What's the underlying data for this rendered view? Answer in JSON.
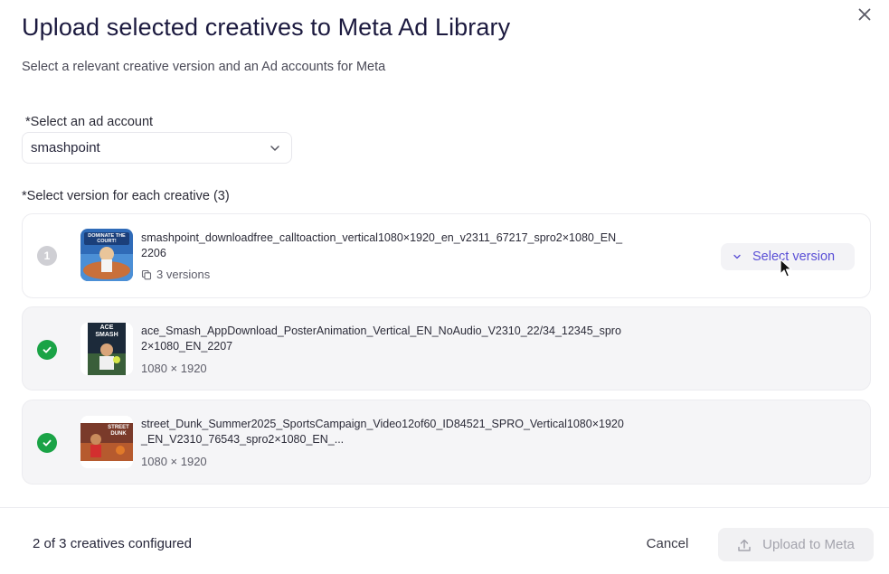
{
  "dialog": {
    "title": "Upload selected creatives to Meta Ad Library",
    "subtitle": "Select a relevant creative version and an Ad accounts for Meta"
  },
  "ad_account": {
    "label": "*Select an ad account",
    "value": "smashpoint"
  },
  "versions": {
    "label": "*Select version for each creative (3)"
  },
  "creatives": [
    {
      "index": "1",
      "status": "pending",
      "name": "smashpoint_downloadfree_calltoaction_vertical1080×1920_en_v2311_67217_spro2×1080_EN_2206",
      "meta": "3 versions",
      "action_label": "Select version",
      "thumb_text": "DOMINATE THE COURT!"
    },
    {
      "status": "done",
      "name": "ace_Smash_AppDownload_PosterAnimation_Vertical_EN_NoAudio_V2310_22/34_12345_spro2×1080_EN_2207",
      "meta": "1080 × 1920",
      "thumb_text": "ACE SMASH"
    },
    {
      "status": "done",
      "name": "street_Dunk_Summer2025_SportsCampaign_Video12of60_ID84521_SPRO_Vertical1080×1920_EN_V2310_76543_spro2×1080_EN_...",
      "meta": "1080 × 1920",
      "thumb_text": "STREET DUNK"
    }
  ],
  "footer": {
    "status": "2 of 3 creatives configured",
    "cancel_label": "Cancel",
    "upload_label": "Upload to Meta"
  },
  "colors": {
    "accent": "#5a4fd6",
    "success": "#1aa346",
    "title": "#1c1a3f"
  },
  "icons": {
    "close": "close-icon",
    "dropdown": "chevron-down-icon",
    "versions": "copy-icon",
    "check": "check-icon",
    "upload": "upload-icon"
  }
}
